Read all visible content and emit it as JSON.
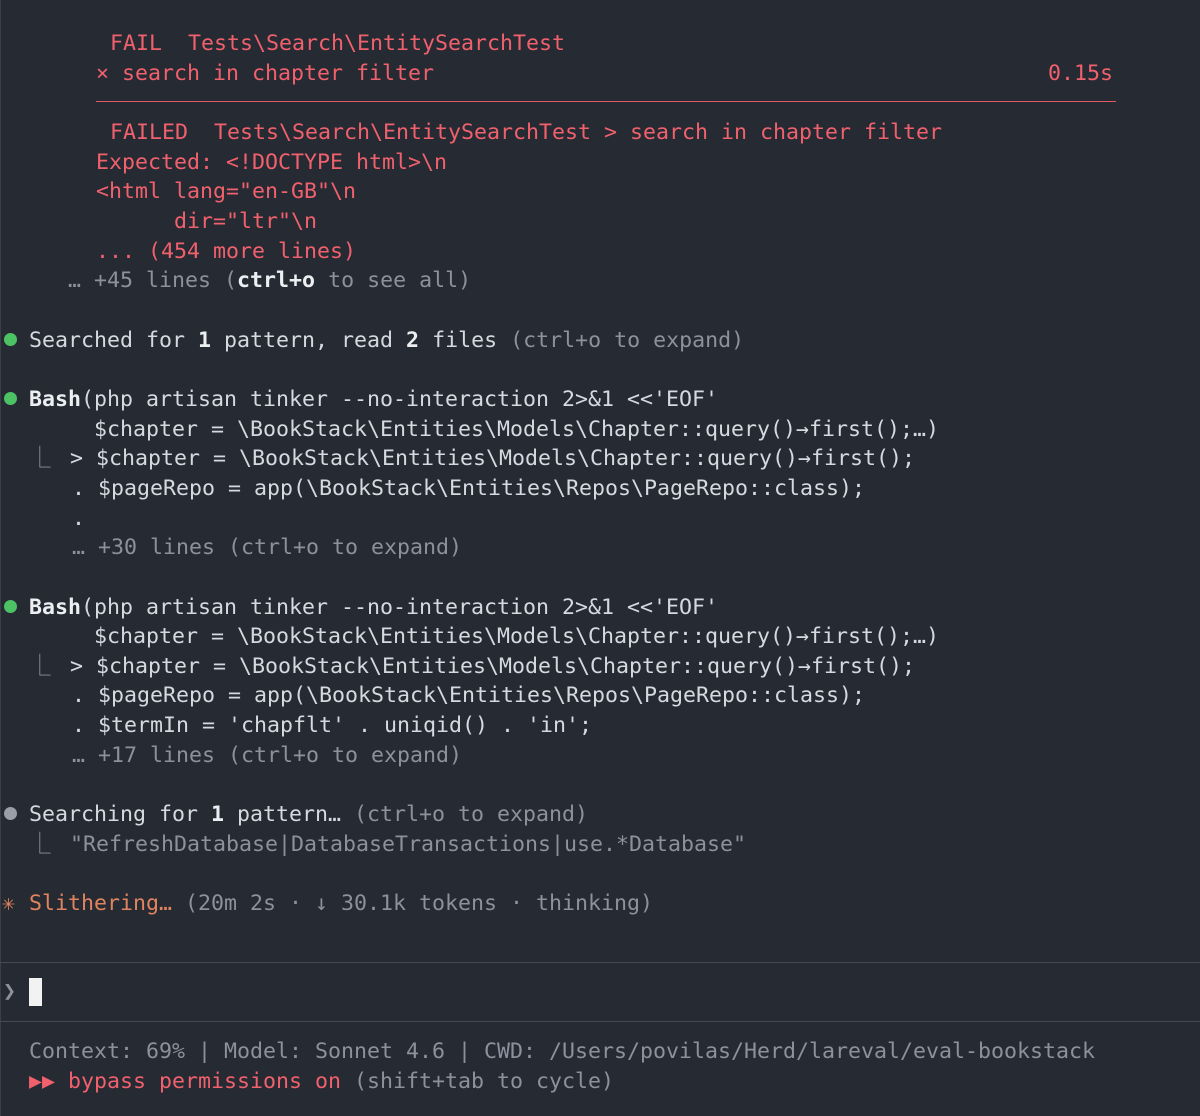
{
  "fail_block": {
    "fail_label": "FAIL",
    "fail_test": "Tests\\Search\\EntitySearchTest",
    "cross": "×",
    "case_name": "search in chapter filter",
    "duration": "0.15s",
    "failed_label": "FAILED",
    "failed_path": "Tests\\Search\\EntitySearchTest > search in chapter filter",
    "expected": "Expected: <!DOCTYPE html>\\n",
    "html_line": "<html lang=\"en-GB\"\\n",
    "dir_line": "      dir=\"ltr\"\\n",
    "more_lines": "... (454 more lines)",
    "ellipsis": "…",
    "more_plus": "+45 lines (",
    "more_key": "ctrl+o",
    "more_tail": " to see all)"
  },
  "search_done": {
    "w1": "Searched for ",
    "n1": "1",
    "w2": " pattern, read ",
    "n2": "2",
    "w3": " files ",
    "hint": "(ctrl+o to expand)"
  },
  "bash1": {
    "tool": "Bash",
    "cmd": "(php artisan tinker --no-interaction 2>&1 <<'EOF'",
    "cmd2": "     $chapter = \\BookStack\\Entities\\Models\\Chapter::query()→first();…)",
    "out_branch": "⎿",
    "out1": "  > $chapter = \\BookStack\\Entities\\Models\\Chapter::query()→first();",
    "out2": "    . $pageRepo = app(\\BookStack\\Entities\\Repos\\PageRepo::class);",
    "out3": "    .",
    "more": "    … +30 lines (ctrl+o to expand)"
  },
  "bash2": {
    "tool": "Bash",
    "cmd": "(php artisan tinker --no-interaction 2>&1 <<'EOF'",
    "cmd2": "     $chapter = \\BookStack\\Entities\\Models\\Chapter::query()→first();…)",
    "out_branch": "⎿",
    "out1": "  > $chapter = \\BookStack\\Entities\\Models\\Chapter::query()→first();",
    "out2": "    . $pageRepo = app(\\BookStack\\Entities\\Repos\\PageRepo::class);",
    "out3": "    . $termIn = 'chapflt' . uniqid() . 'in';",
    "more": "    … +17 lines (ctrl+o to expand)"
  },
  "searching": {
    "w1": "Searching for ",
    "n1": "1",
    "w2": " pattern… ",
    "hint": "(ctrl+o to expand)",
    "branch": "⎿",
    "pattern": "  \"RefreshDatabase|DatabaseTransactions|use.*Database\""
  },
  "status": {
    "spinner": "✳",
    "verb": "Slithering…",
    "info": " (20m 2s · ↓ 30.1k tokens · thinking)"
  },
  "prompt": {
    "chevron": "❯"
  },
  "footer": {
    "context": "Context: 69% | Model: Sonnet 4.6 | CWD: /Users/povilas/Herd/lareval/eval-bookstack",
    "mode_icon": "▶▶",
    "mode": " bypass permissions on",
    "mode_hint": " (shift+tab to cycle)"
  },
  "colors": {
    "background": "#262a33",
    "error_red": "#f0616d",
    "success_green": "#4cc265",
    "status_orange": "#e0835f"
  }
}
